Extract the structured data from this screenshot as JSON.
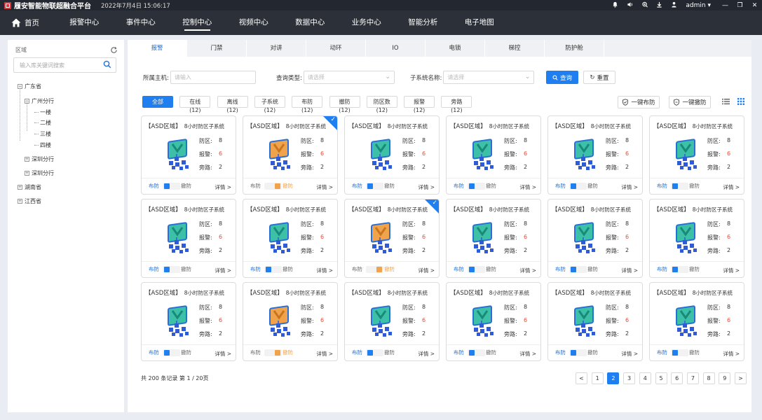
{
  "app": {
    "title": "履安智能物联超融合平台",
    "datetime": "2022年7月4日 15:06:17",
    "user": "admin"
  },
  "icons": {
    "logo": "brand-logo-icon",
    "bell": "bell-icon",
    "volume": "volume-icon",
    "zoom": "zoom-icon",
    "download": "download-icon",
    "user": "user-icon",
    "minimize": "minimize-icon",
    "restore": "restore-icon",
    "close": "close-icon",
    "home": "home-icon",
    "search": "search-icon",
    "refresh": "refresh-icon",
    "arm": "shield-check-icon",
    "disarm": "shield-off-icon",
    "list": "list-view-icon",
    "grid": "grid-view-icon"
  },
  "nav": {
    "home": "首页",
    "items": [
      "报警中心",
      "事件中心",
      "控制中心",
      "视频中心",
      "数据中心",
      "业务中心",
      "智能分析",
      "电子地图"
    ],
    "active": "控制中心"
  },
  "sidebar": {
    "header": "区域",
    "search_placeholder": "输入库关键词搜索",
    "tree": [
      {
        "label": "广东省",
        "toggle": "−",
        "level": 0
      },
      {
        "label": "广州分行",
        "toggle": "−",
        "level": 1
      },
      {
        "label": "一楼",
        "toggle": "",
        "level": 2
      },
      {
        "label": "二楼",
        "toggle": "",
        "level": 2
      },
      {
        "label": "三楼",
        "toggle": "",
        "level": 2
      },
      {
        "label": "四楼",
        "toggle": "",
        "level": 2
      },
      {
        "label": "深圳分行",
        "toggle": "+",
        "level": 1
      },
      {
        "label": "深圳分行",
        "toggle": "+",
        "level": 1
      },
      {
        "label": "湖南省",
        "toggle": "+",
        "level": 0
      },
      {
        "label": "江西省",
        "toggle": "+",
        "level": 0
      }
    ]
  },
  "tabs": [
    "报警",
    "门禁",
    "对讲",
    "动环",
    "IO",
    "电锁",
    "梯控",
    "防护舱"
  ],
  "active_tab": "报警",
  "filters": {
    "host_label": "所属主机:",
    "host_placeholder": "请输入",
    "type_label": "查询类型:",
    "type_placeholder": "请选择",
    "subsys_label": "子系统名称:",
    "subsys_placeholder": "请选择",
    "query": "查询",
    "reset": "重置"
  },
  "chips": [
    {
      "label": "全部",
      "count": ""
    },
    {
      "label": "在线",
      "count": "(12)"
    },
    {
      "label": "离线",
      "count": "(12)"
    },
    {
      "label": "子系统",
      "count": "(12)"
    },
    {
      "label": "布防",
      "count": "(12)"
    },
    {
      "label": "撤防",
      "count": "(12)"
    },
    {
      "label": "防区数",
      "count": "(12)"
    },
    {
      "label": "报警",
      "count": "(12)"
    },
    {
      "label": "旁路",
      "count": "(12)"
    }
  ],
  "actions": {
    "arm_all": "一键布防",
    "disarm_all": "一键撤防"
  },
  "card_text": {
    "title": "【ASD区域】",
    "subtitle": "8小时防区子系统",
    "zone_label": "防区:",
    "zone_value": "8",
    "alarm_label": "报警:",
    "alarm_value": "6",
    "bypass_label": "旁路:",
    "bypass_value": "2",
    "arm": "布防",
    "disarm": "撤防",
    "detail": "详情 >"
  },
  "cards": [
    {
      "armed": true,
      "selected": false
    },
    {
      "armed": false,
      "selected": true
    },
    {
      "armed": true,
      "selected": false
    },
    {
      "armed": true,
      "selected": false
    },
    {
      "armed": true,
      "selected": false
    },
    {
      "armed": true,
      "selected": false
    },
    {
      "armed": true,
      "selected": false
    },
    {
      "armed": true,
      "selected": false
    },
    {
      "armed": false,
      "selected": true
    },
    {
      "armed": true,
      "selected": false
    },
    {
      "armed": true,
      "selected": false
    },
    {
      "armed": true,
      "selected": false
    },
    {
      "armed": true,
      "selected": false
    },
    {
      "armed": false,
      "selected": false
    },
    {
      "armed": true,
      "selected": false
    },
    {
      "armed": true,
      "selected": false
    },
    {
      "armed": true,
      "selected": false
    },
    {
      "armed": true,
      "selected": false
    }
  ],
  "colors": {
    "accent": "#1f7ff0",
    "armed_icon": "#3cc0a8",
    "disarmed_icon": "#f0a34a",
    "alarm": "#e74c3c"
  },
  "pagination": {
    "summary": "共 200 条记录 第 1 / 20页",
    "prev": "<",
    "next": ">",
    "pages": [
      "1",
      "2",
      "3",
      "4",
      "5",
      "6",
      "7",
      "8",
      "9"
    ],
    "current": "2"
  }
}
